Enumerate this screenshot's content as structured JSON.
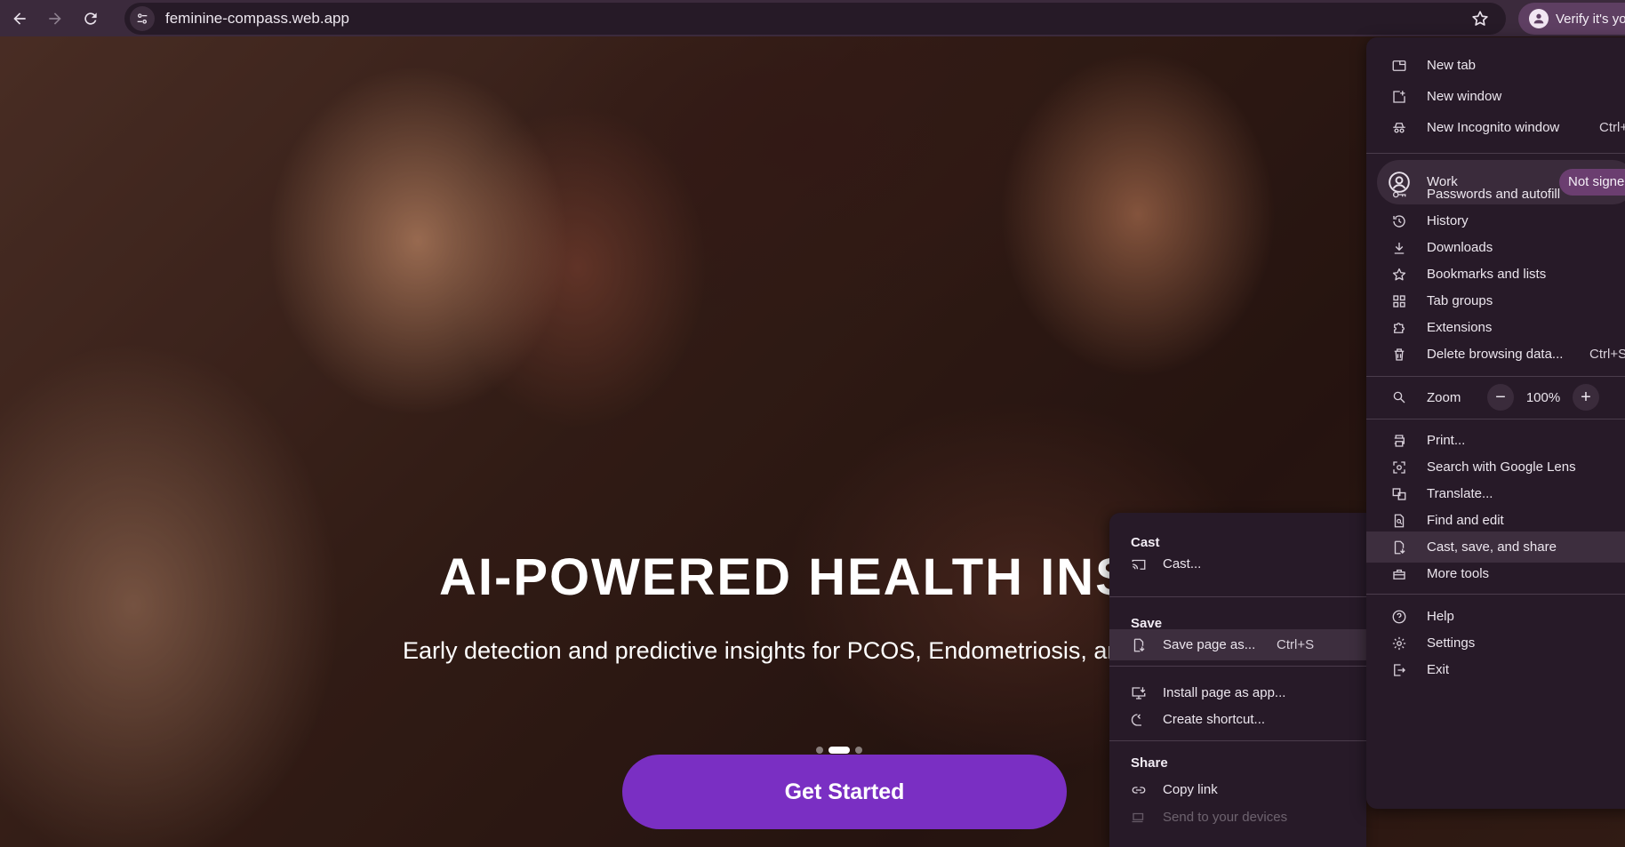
{
  "browser": {
    "url": "feminine-compass.web.app",
    "profile_chip": "Verify it's you"
  },
  "hero": {
    "title": "AI-POWERED HEALTH INSIGHTS",
    "subtitle": "Early detection and predictive insights for PCOS, Endometriosis, and more",
    "cta": "Get Started",
    "slides": 3,
    "active_slide": 2
  },
  "main_menu": {
    "new_tab": "New tab",
    "new_window": "New window",
    "new_incognito": "New Incognito window",
    "new_incognito_shortcut": "Ctrl+Shift+N",
    "profile_name": "Work",
    "profile_status": "Not signed in",
    "passwords": "Passwords and autofill",
    "history": "History",
    "downloads": "Downloads",
    "bookmarks": "Bookmarks and lists",
    "tab_groups": "Tab groups",
    "extensions": "Extensions",
    "delete_data": "Delete browsing data...",
    "delete_data_shortcut": "Ctrl+Shift+Del",
    "zoom_label": "Zoom",
    "zoom_minus": "−",
    "zoom_value": "100%",
    "zoom_plus": "+",
    "print": "Print...",
    "lens": "Search with Google Lens",
    "translate": "Translate...",
    "find_edit": "Find and edit",
    "cast_save_share": "Cast, save, and share",
    "more_tools": "More tools",
    "help": "Help",
    "settings": "Settings",
    "exit": "Exit"
  },
  "sub_menu": {
    "cast_heading": "Cast",
    "cast_item": "Cast...",
    "save_heading": "Save",
    "save_page": "Save page as...",
    "save_page_shortcut": "Ctrl+S",
    "install_app": "Install page as app...",
    "create_shortcut": "Create shortcut...",
    "share_heading": "Share",
    "copy_link": "Copy link",
    "send_devices": "Send to your devices"
  }
}
